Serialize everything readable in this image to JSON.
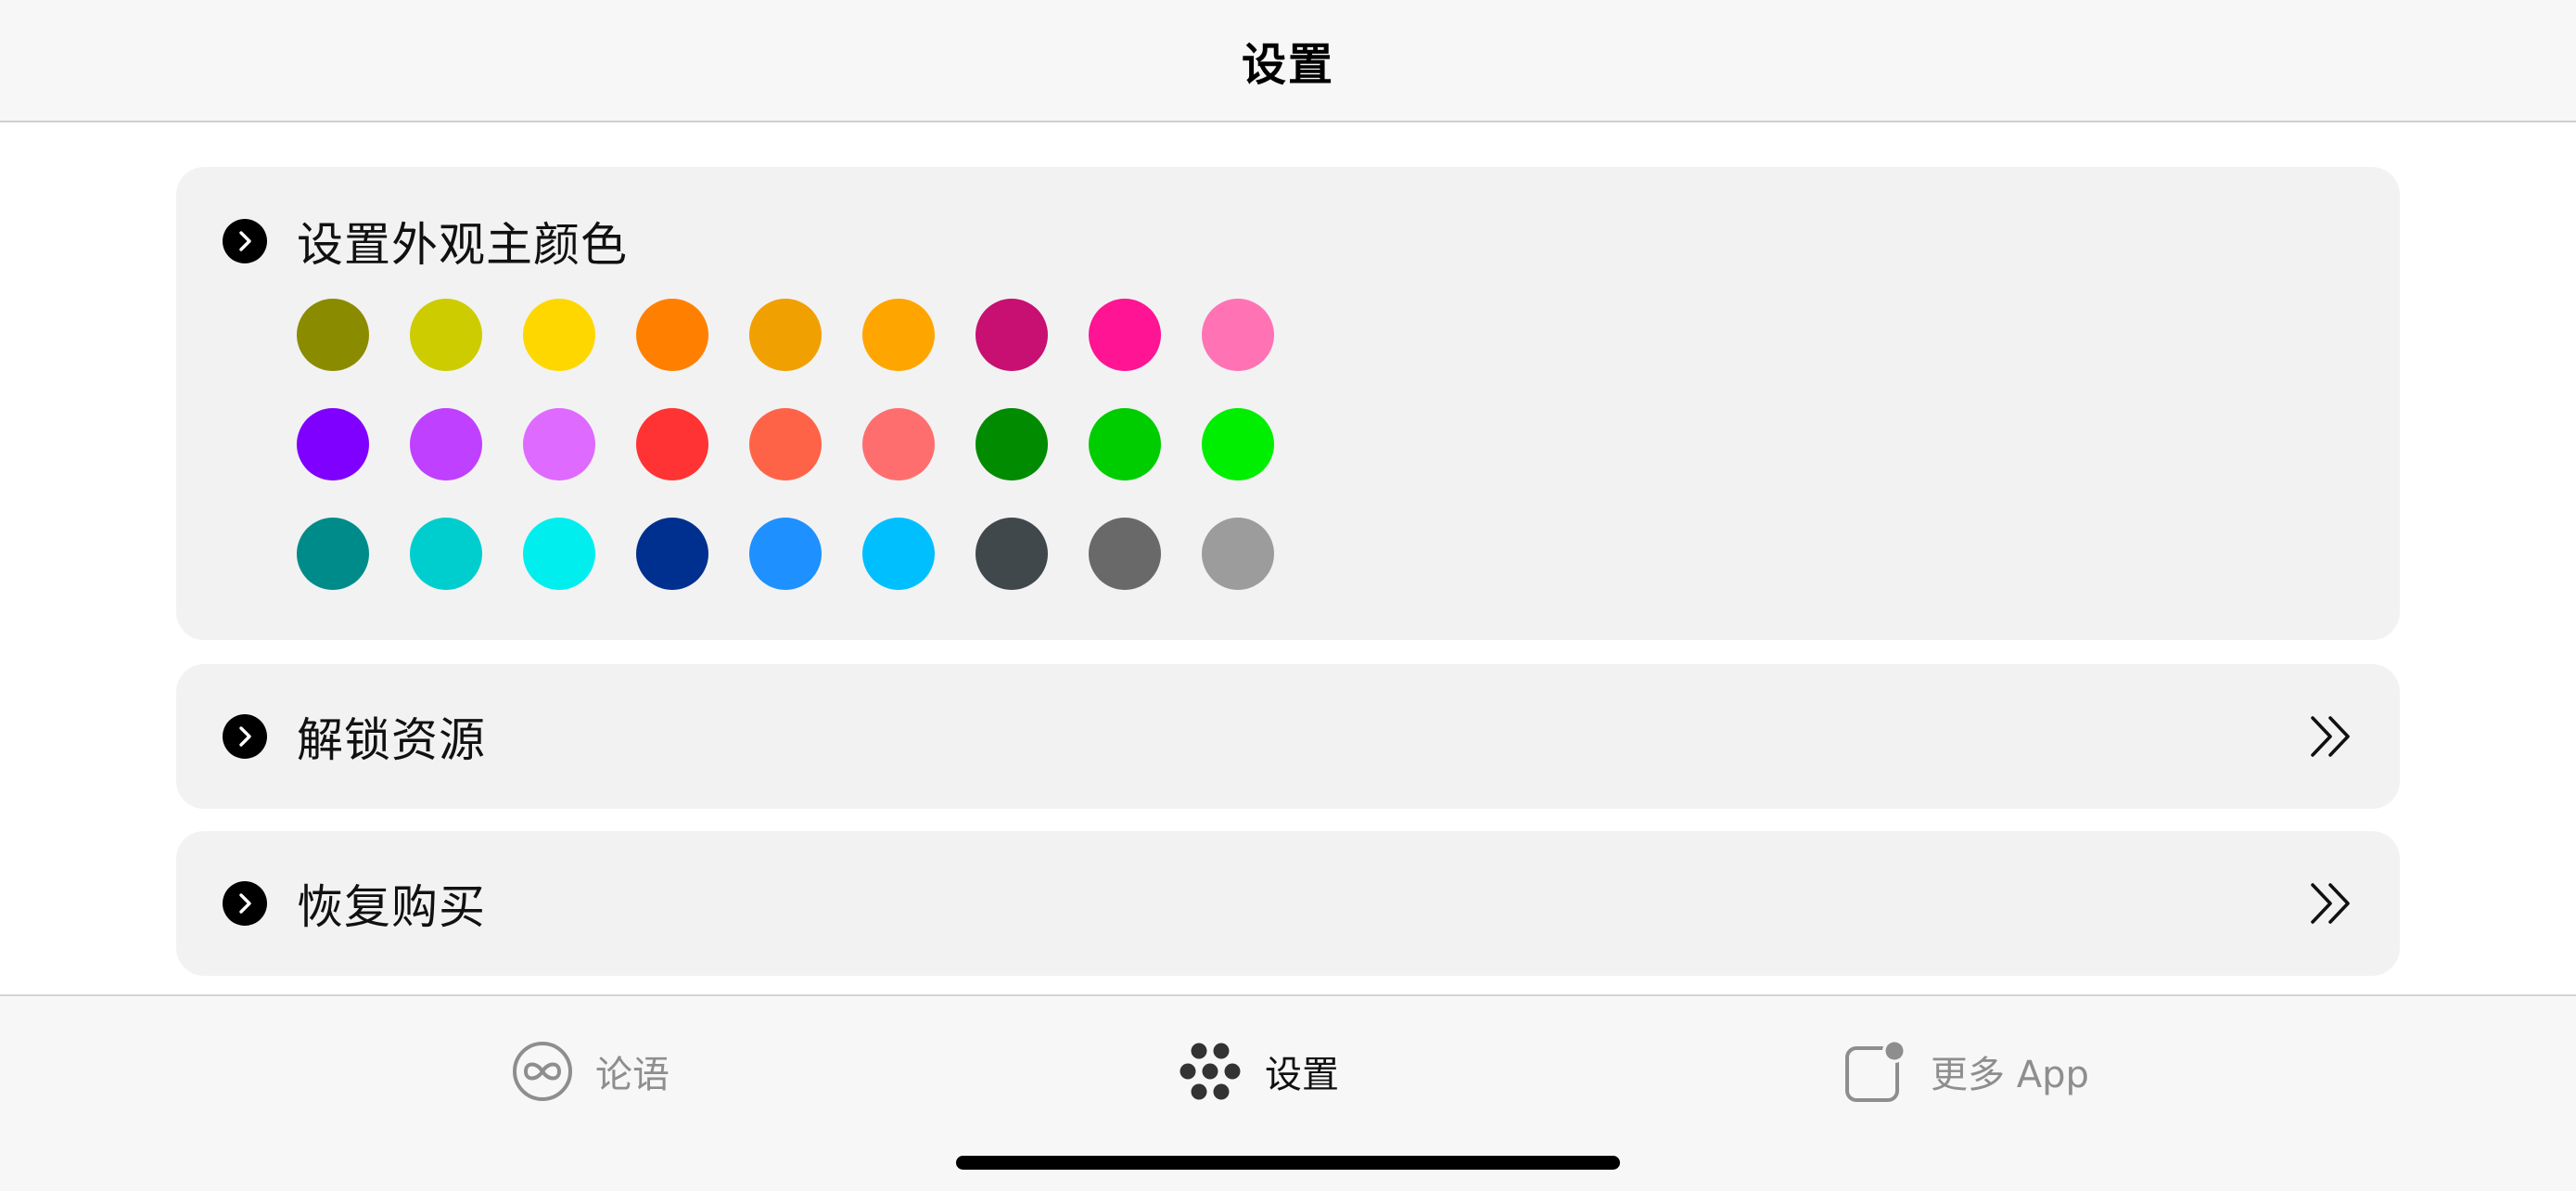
{
  "navbar": {
    "title": "设置"
  },
  "sections": {
    "color": {
      "label": "设置外观主颜色"
    },
    "unlock": {
      "label": "解锁资源"
    },
    "restore": {
      "label": "恢复购买"
    }
  },
  "swatches": [
    [
      "#8b8b00",
      "#cccc00",
      "#ffd700",
      "#ff8000",
      "#f0a000",
      "#ffa500",
      "#c71071",
      "#ff1493",
      "#ff73b4"
    ],
    [
      "#8000ff",
      "#bf40ff",
      "#df6aff",
      "#ff3333",
      "#ff6347",
      "#ff6e6e",
      "#008b00",
      "#00cd00",
      "#00ee00"
    ],
    [
      "#008b8b",
      "#00cdcd",
      "#00eeee",
      "#00308f",
      "#1e90ff",
      "#00bfff",
      "#40484c",
      "#696969",
      "#9c9c9c"
    ]
  ],
  "tabbar": {
    "tabs": [
      {
        "label": "论语",
        "icon": "infinity-icon"
      },
      {
        "label": "设置",
        "icon": "dots-grid-icon",
        "selected": true
      },
      {
        "label": "更多 App",
        "icon": "app-badge-icon"
      }
    ]
  },
  "colors": {
    "card_background": "#f2f2f2",
    "tab_inactive": "#8e8e8e",
    "tab_active": "#111111"
  }
}
